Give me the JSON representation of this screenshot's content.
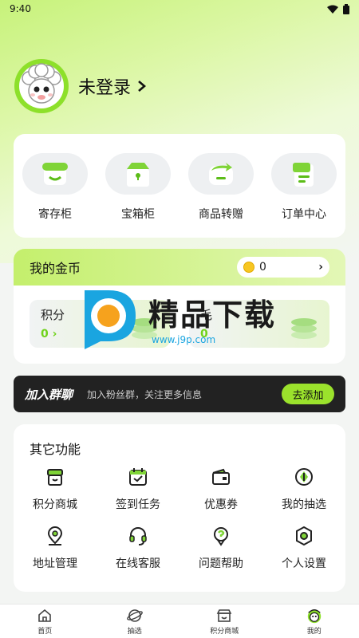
{
  "status": {
    "time": "9:40"
  },
  "profile": {
    "login_label": "未登录"
  },
  "quick_actions": [
    {
      "label": "寄存柜",
      "icon": "locker-icon"
    },
    {
      "label": "宝箱柜",
      "icon": "treasure-box-icon"
    },
    {
      "label": "商品转赠",
      "icon": "transfer-icon"
    },
    {
      "label": "订单中心",
      "icon": "order-icon"
    }
  ],
  "coins": {
    "title": "我的金币",
    "coin_value": "0",
    "points_label": "积分",
    "points_value": "0 ›",
    "fur_label": "毛",
    "fur_value": "0"
  },
  "group": {
    "title": "加入群聊",
    "description": "加入粉丝群，关注更多信息",
    "button": "去添加"
  },
  "features": {
    "title": "其它功能",
    "items": [
      {
        "label": "积分商城",
        "icon": "store-icon"
      },
      {
        "label": "签到任务",
        "icon": "calendar-check-icon"
      },
      {
        "label": "优惠券",
        "icon": "coupon-icon"
      },
      {
        "label": "我的抽选",
        "icon": "draw-icon"
      },
      {
        "label": "地址管理",
        "icon": "location-icon"
      },
      {
        "label": "在线客服",
        "icon": "headset-icon"
      },
      {
        "label": "问题帮助",
        "icon": "help-icon"
      },
      {
        "label": "个人设置",
        "icon": "settings-icon"
      }
    ]
  },
  "tabbar": [
    {
      "label": "首页",
      "icon": "home-icon"
    },
    {
      "label": "抽选",
      "icon": "planet-icon"
    },
    {
      "label": "积分商城",
      "icon": "shop-icon"
    },
    {
      "label": "我的",
      "icon": "sheep-icon"
    }
  ],
  "watermark": {
    "title": "精品下载",
    "url": "www.j9p.com"
  },
  "colors": {
    "accent": "#9be22c",
    "accent_dark": "#6fd21a",
    "banner_bg": "#222222"
  }
}
